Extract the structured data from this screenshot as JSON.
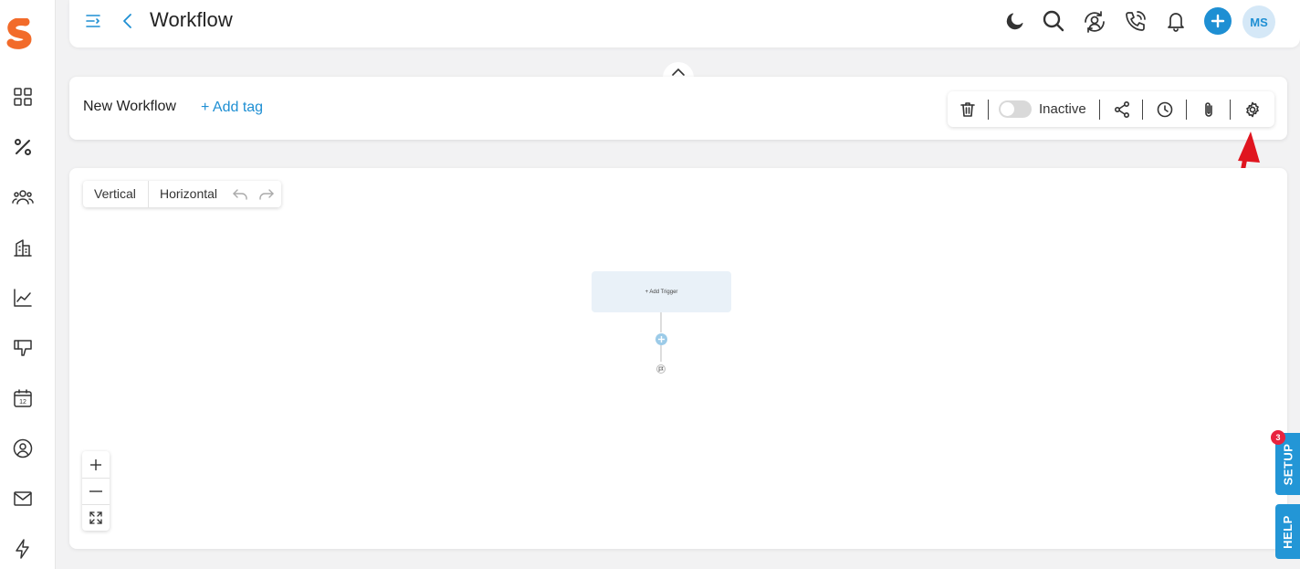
{
  "header": {
    "title": "Workflow",
    "avatar_initials": "MS"
  },
  "workflow": {
    "name": "New Workflow",
    "add_tag_label": "+ Add tag",
    "status_label": "Inactive",
    "active": false
  },
  "canvas": {
    "orientation": {
      "vertical_label": "Vertical",
      "horizontal_label": "Horizontal"
    },
    "trigger_label": "+ Add Trigger"
  },
  "side_tabs": {
    "setup_label": "SETUP",
    "setup_badge": "3",
    "help_label": "HELP"
  },
  "icons": {
    "sidebar": [
      "dashboard-icon",
      "percent-icon",
      "users-icon",
      "buildings-icon",
      "chart-line-icon",
      "thumbs-down-icon",
      "calendar-icon",
      "user-circle-icon",
      "mail-icon",
      "lightning-icon"
    ],
    "header": [
      "menu-collapse-icon",
      "back-chevron-icon",
      "moon-icon",
      "search-icon",
      "user-sync-icon",
      "phone-icon",
      "bell-icon",
      "plus-icon"
    ],
    "toolbar": [
      "trash-icon",
      "share-icon",
      "clock-icon",
      "paperclip-icon",
      "gear-icon"
    ]
  },
  "colors": {
    "accent": "#1e8fd3",
    "logo": "#f26b2a",
    "badge": "#e8233f",
    "annotation_arrow": "#e0151f",
    "trigger_bg": "#e9f1f8"
  }
}
